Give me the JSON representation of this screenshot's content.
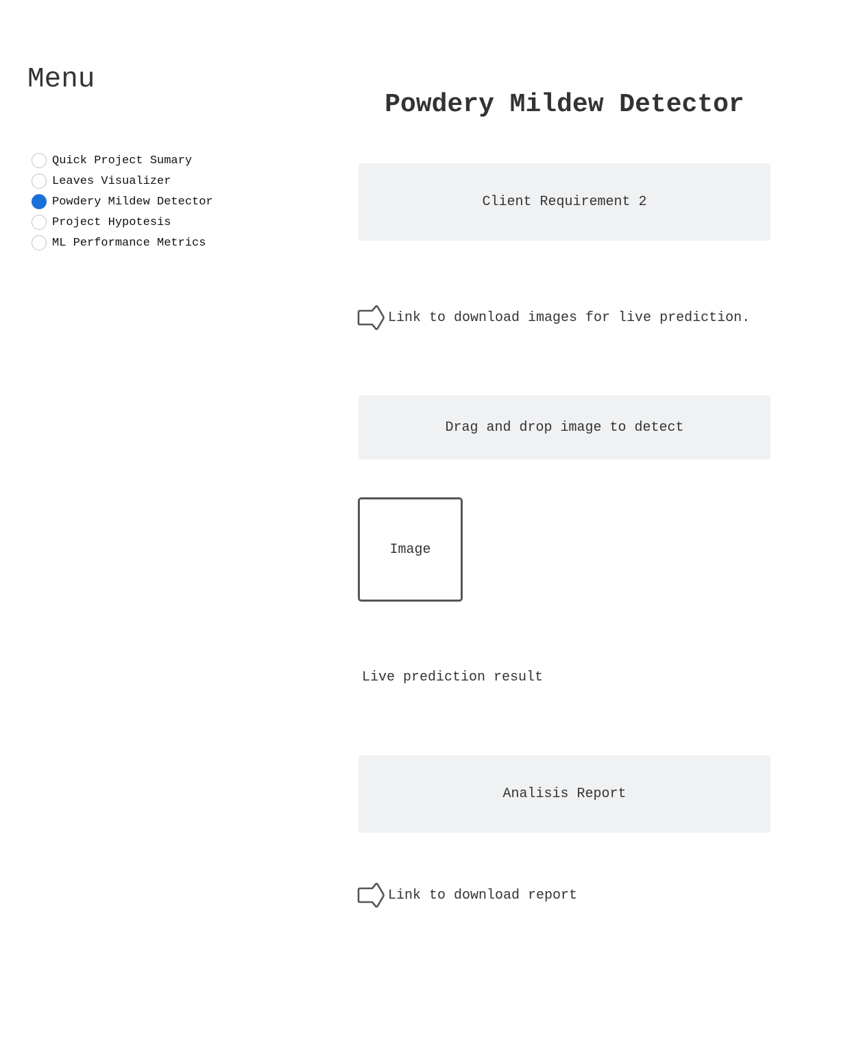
{
  "sidebar": {
    "title": "Menu",
    "items": [
      {
        "label": "Quick Project Sumary",
        "selected": false
      },
      {
        "label": "Leaves Visualizer",
        "selected": false
      },
      {
        "label": "Powdery Mildew Detector",
        "selected": true
      },
      {
        "label": "Project Hypotesis",
        "selected": false
      },
      {
        "label": "ML Performance Metrics",
        "selected": false
      }
    ]
  },
  "main": {
    "title": "Powdery Mildew Detector",
    "requirement_panel": "Client Requirement 2",
    "download_images_link": "Link to download images for live prediction.",
    "upload_panel": "Drag and drop image to detect",
    "image_placeholder": "Image",
    "result_text": "Live prediction result",
    "report_panel": "Analisis Report",
    "download_report_link": "Link to download report"
  },
  "colors": {
    "accent": "#1b6fd9",
    "panel_background": "#f0f1f3",
    "text": "#333333"
  },
  "icons": {
    "link_icon": "arrow-right-outline-icon"
  }
}
